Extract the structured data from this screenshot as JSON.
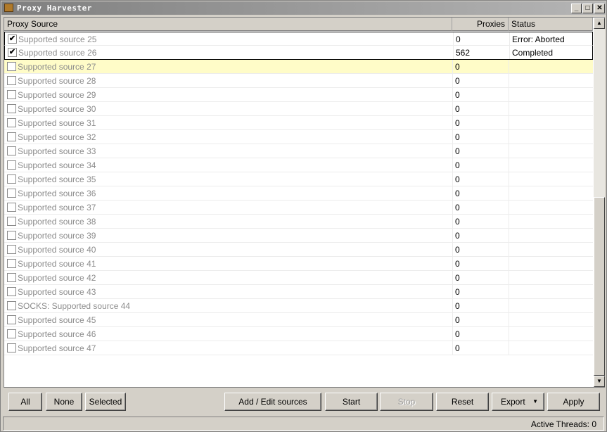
{
  "window": {
    "title": "Proxy Harvester"
  },
  "grid": {
    "columns": [
      "Proxy Source",
      "Proxies",
      "Status"
    ],
    "rows": [
      {
        "checked": true,
        "source": "Supported source 25",
        "proxies": "0",
        "status": "Error: Aborted"
      },
      {
        "checked": true,
        "source": "Supported source 26",
        "proxies": "562",
        "status": "Completed"
      },
      {
        "checked": false,
        "source": "Supported source 27",
        "proxies": "0",
        "status": ""
      },
      {
        "checked": false,
        "source": "Supported source 28",
        "proxies": "0",
        "status": ""
      },
      {
        "checked": false,
        "source": "Supported source 29",
        "proxies": "0",
        "status": ""
      },
      {
        "checked": false,
        "source": "Supported source 30",
        "proxies": "0",
        "status": ""
      },
      {
        "checked": false,
        "source": "Supported source 31",
        "proxies": "0",
        "status": ""
      },
      {
        "checked": false,
        "source": "Supported source 32",
        "proxies": "0",
        "status": ""
      },
      {
        "checked": false,
        "source": "Supported source 33",
        "proxies": "0",
        "status": ""
      },
      {
        "checked": false,
        "source": "Supported source 34",
        "proxies": "0",
        "status": ""
      },
      {
        "checked": false,
        "source": "Supported source 35",
        "proxies": "0",
        "status": ""
      },
      {
        "checked": false,
        "source": "Supported source 36",
        "proxies": "0",
        "status": ""
      },
      {
        "checked": false,
        "source": "Supported source 37",
        "proxies": "0",
        "status": ""
      },
      {
        "checked": false,
        "source": "Supported source 38",
        "proxies": "0",
        "status": ""
      },
      {
        "checked": false,
        "source": "Supported source 39",
        "proxies": "0",
        "status": ""
      },
      {
        "checked": false,
        "source": "Supported source 40",
        "proxies": "0",
        "status": ""
      },
      {
        "checked": false,
        "source": "Supported source 41",
        "proxies": "0",
        "status": ""
      },
      {
        "checked": false,
        "source": "Supported source 42",
        "proxies": "0",
        "status": ""
      },
      {
        "checked": false,
        "source": "Supported source 43",
        "proxies": "0",
        "status": ""
      },
      {
        "checked": false,
        "source": "SOCKS: Supported source 44",
        "proxies": "0",
        "status": ""
      },
      {
        "checked": false,
        "source": "Supported source 45",
        "proxies": "0",
        "status": ""
      },
      {
        "checked": false,
        "source": "Supported source 46",
        "proxies": "0",
        "status": ""
      },
      {
        "checked": false,
        "source": "Supported source 47",
        "proxies": "0",
        "status": ""
      }
    ],
    "highlight_color": "#fffcc8"
  },
  "buttons": {
    "all": "All",
    "none": "None",
    "selected": "Selected",
    "add_edit": "Add / Edit sources",
    "start": "Start",
    "stop": "Stop",
    "reset": "Reset",
    "export": "Export",
    "apply": "Apply"
  },
  "status": {
    "active_threads": "Active Threads: 0"
  },
  "icons": [
    "app-icon",
    "minimize-icon",
    "maximize-icon",
    "close-icon",
    "scroll-up-icon",
    "scroll-down-icon",
    "dropdown-arrow-icon",
    "checkmark-icon"
  ]
}
